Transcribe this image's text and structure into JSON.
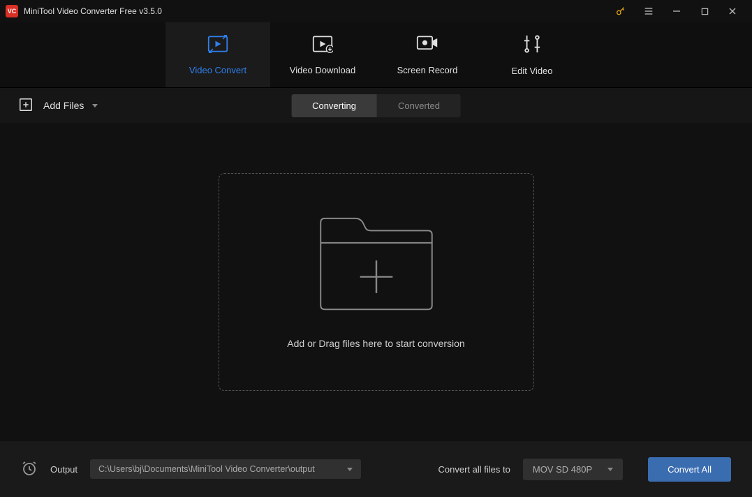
{
  "titlebar": {
    "app_name": "MiniTool Video Converter Free v3.5.0",
    "logo_text": "VC"
  },
  "nav": {
    "tabs": [
      {
        "label": "Video Convert",
        "active": true
      },
      {
        "label": "Video Download",
        "active": false
      },
      {
        "label": "Screen Record",
        "active": false
      },
      {
        "label": "Edit Video",
        "active": false
      }
    ]
  },
  "toolbar": {
    "add_files_label": "Add Files",
    "segments": {
      "converting": "Converting",
      "converted": "Converted"
    }
  },
  "dropzone": {
    "text": "Add or Drag files here to start conversion"
  },
  "bottom": {
    "output_label": "Output",
    "output_path": "C:\\Users\\bj\\Documents\\MiniTool Video Converter\\output",
    "convert_all_files_label": "Convert all files to",
    "format": "MOV SD 480P",
    "convert_all_button": "Convert All"
  }
}
